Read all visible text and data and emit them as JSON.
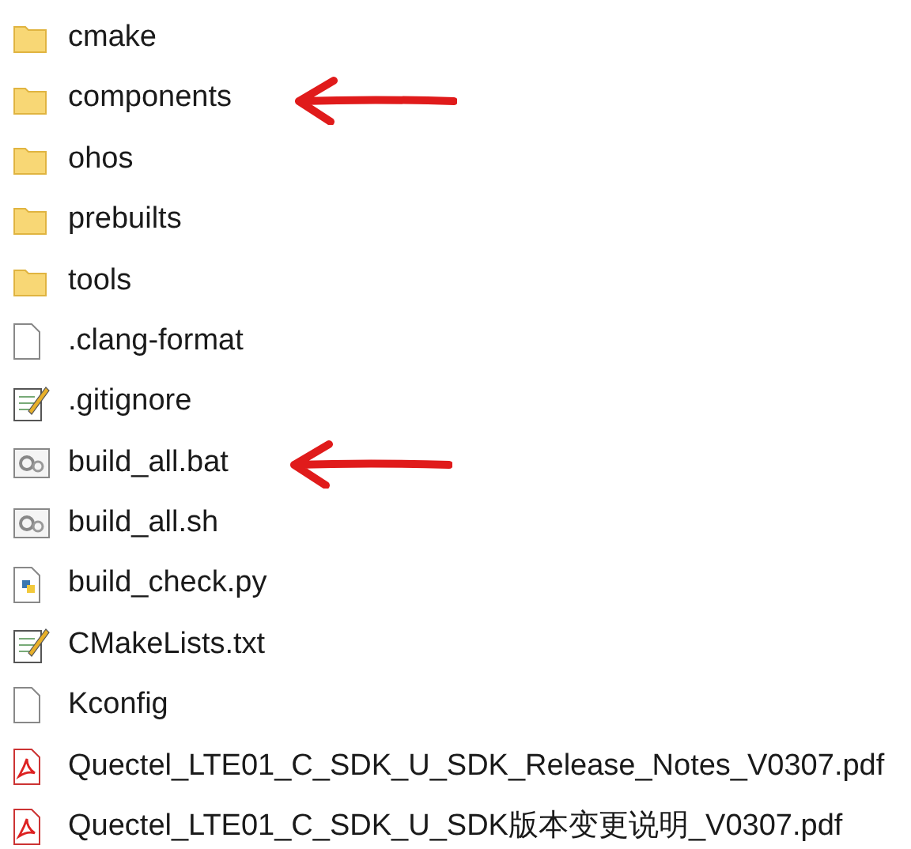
{
  "files": [
    {
      "name": "cmake",
      "kind": "folder",
      "marked": false
    },
    {
      "name": "components",
      "kind": "folder",
      "marked": true
    },
    {
      "name": "ohos",
      "kind": "folder",
      "marked": false
    },
    {
      "name": "prebuilts",
      "kind": "folder",
      "marked": false
    },
    {
      "name": "tools",
      "kind": "folder",
      "marked": false
    },
    {
      "name": ".clang-format",
      "kind": "file",
      "marked": false
    },
    {
      "name": ".gitignore",
      "kind": "text",
      "marked": false
    },
    {
      "name": "build_all.bat",
      "kind": "script",
      "marked": true
    },
    {
      "name": "build_all.sh",
      "kind": "script",
      "marked": false
    },
    {
      "name": "build_check.py",
      "kind": "python",
      "marked": false
    },
    {
      "name": "CMakeLists.txt",
      "kind": "text",
      "marked": false
    },
    {
      "name": "Kconfig",
      "kind": "file",
      "marked": false
    },
    {
      "name": "Quectel_LTE01_C_SDK_U_SDK_Release_Notes_V0307.pdf",
      "kind": "pdf",
      "marked": false
    },
    {
      "name": "Quectel_LTE01_C_SDK_U_SDK版本变更说明_V0307.pdf",
      "kind": "pdf",
      "marked": false
    }
  ]
}
